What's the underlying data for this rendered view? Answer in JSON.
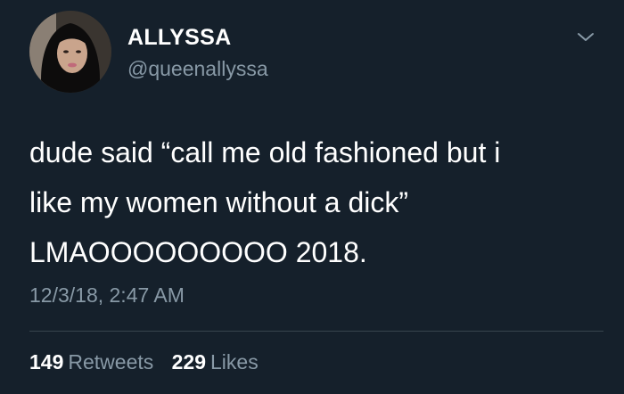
{
  "user": {
    "name": "ALLYSSA",
    "handle": "@queenallyssa"
  },
  "tweet": {
    "lines": [
      "dude said “call me old fashioned but i",
      "like my women without a dick”",
      "LMAOOOOOOOOO 2018."
    ],
    "timestamp": "12/3/18, 2:47 AM"
  },
  "stats": {
    "retweets_count": "149",
    "retweets_label": "Retweets",
    "likes_count": "229",
    "likes_label": "Likes"
  },
  "icons": {
    "menu": "chevron-down-icon",
    "avatar": "avatar"
  },
  "colors": {
    "background": "#15202b",
    "text": "#ffffff",
    "secondary_text": "#8899a6",
    "divider": "#38444d"
  }
}
